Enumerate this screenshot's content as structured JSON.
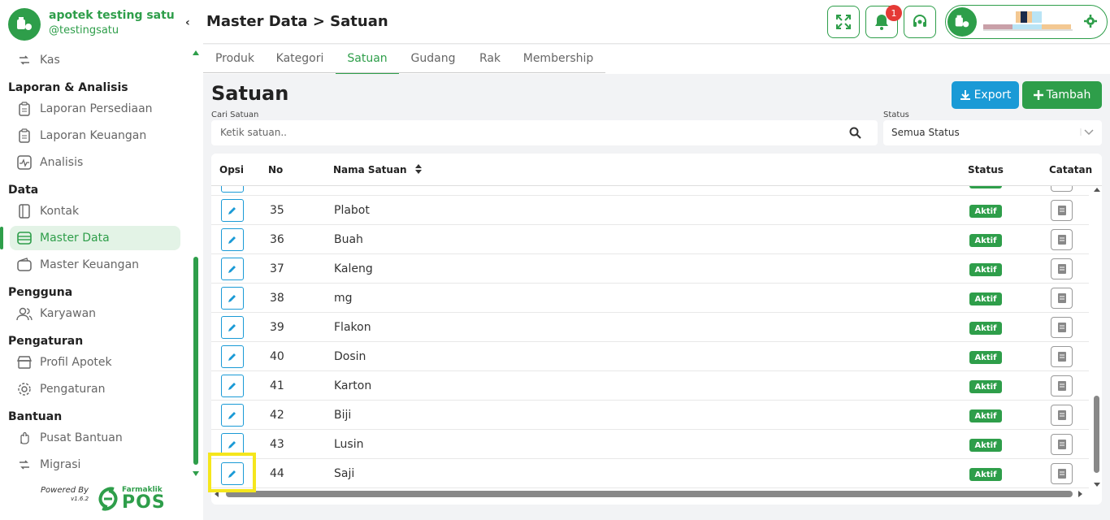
{
  "brand": {
    "name": "apotek testing satu",
    "handle": "@testingsatu"
  },
  "sidebar": {
    "items": [
      {
        "label": "Kas"
      },
      {
        "label": "Laporan Persediaan"
      },
      {
        "label": "Laporan Keuangan"
      },
      {
        "label": "Analisis"
      },
      {
        "label": "Kontak"
      },
      {
        "label": "Master Data"
      },
      {
        "label": "Master Keuangan"
      },
      {
        "label": "Karyawan"
      },
      {
        "label": "Profil Apotek"
      },
      {
        "label": "Pengaturan"
      },
      {
        "label": "Pusat Bantuan"
      },
      {
        "label": "Migrasi"
      }
    ],
    "sections": {
      "laporan": "Laporan & Analisis",
      "data": "Data",
      "pengguna": "Pengguna",
      "pengaturan": "Pengaturan",
      "bantuan": "Bantuan"
    },
    "powered_by": "Powered By",
    "version": "v1.6.2",
    "logo_top": "Farmaklik",
    "logo_bottom": "POS"
  },
  "header": {
    "title": "Master Data > Satuan",
    "notification_count": "1"
  },
  "tabs": [
    "Produk",
    "Kategori",
    "Satuan",
    "Gudang",
    "Rak",
    "Membership"
  ],
  "page": {
    "heading": "Satuan",
    "export_label": "Export",
    "add_label": "Tambah",
    "search_label": "Cari Satuan",
    "search_placeholder": "Ketik satuan..",
    "status_label": "Status",
    "status_value": "Semua Status"
  },
  "table": {
    "columns": {
      "opsi": "Opsi",
      "no": "No",
      "nama": "Nama Satuan",
      "status": "Status",
      "catatan": "Catatan"
    },
    "rows": [
      {
        "no": "35",
        "name": "Plabot",
        "status": "Aktif"
      },
      {
        "no": "36",
        "name": "Buah",
        "status": "Aktif"
      },
      {
        "no": "37",
        "name": "Kaleng",
        "status": "Aktif"
      },
      {
        "no": "38",
        "name": "mg",
        "status": "Aktif"
      },
      {
        "no": "39",
        "name": "Flakon",
        "status": "Aktif"
      },
      {
        "no": "40",
        "name": "Dosin",
        "status": "Aktif"
      },
      {
        "no": "41",
        "name": "Karton",
        "status": "Aktif"
      },
      {
        "no": "42",
        "name": "Biji",
        "status": "Aktif"
      },
      {
        "no": "43",
        "name": "Lusin",
        "status": "Aktif"
      },
      {
        "no": "44",
        "name": "Saji",
        "status": "Aktif"
      }
    ]
  },
  "colors": {
    "primary": "#2e9e4a",
    "info": "#1a9ad6",
    "highlight": "#f5e61c",
    "danger": "#e53935"
  }
}
